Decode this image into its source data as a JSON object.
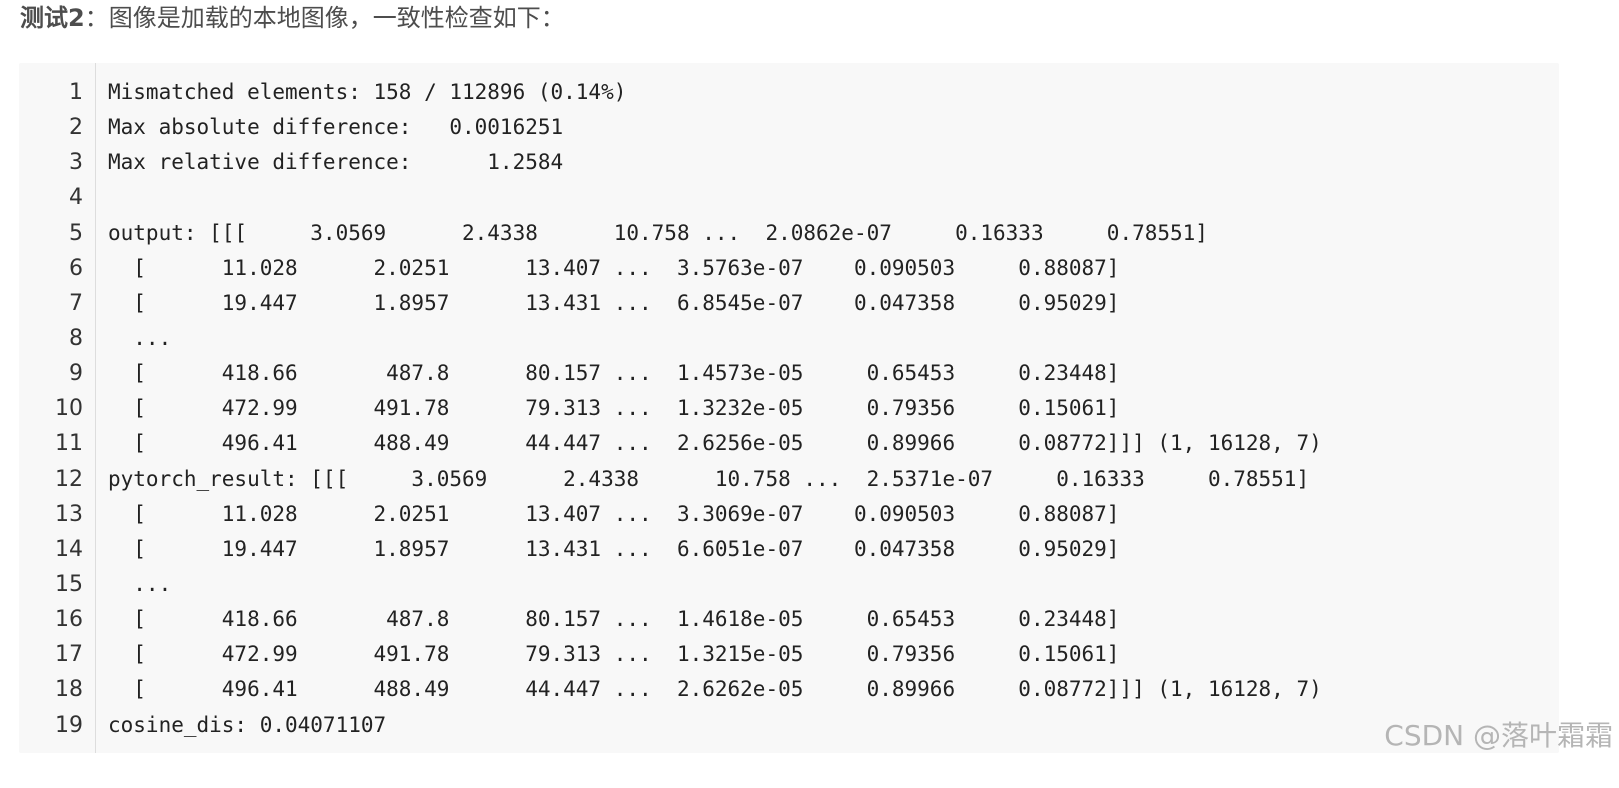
{
  "heading": {
    "bold": "测试2",
    "rest": "：图像是加载的本地图像，一致性检查如下："
  },
  "code": {
    "lines": [
      {
        "no": "1",
        "text": "Mismatched elements: 158 / 112896 (0.14%)"
      },
      {
        "no": "2",
        "text": "Max absolute difference:   0.0016251"
      },
      {
        "no": "3",
        "text": "Max relative difference:      1.2584"
      },
      {
        "no": "4",
        "text": ""
      },
      {
        "no": "5",
        "text": "output: [[[     3.0569      2.4338      10.758 ...  2.0862e-07     0.16333     0.78551]"
      },
      {
        "no": "6",
        "text": "  [      11.028      2.0251      13.407 ...  3.5763e-07    0.090503     0.88087]"
      },
      {
        "no": "7",
        "text": "  [      19.447      1.8957      13.431 ...  6.8545e-07    0.047358     0.95029]"
      },
      {
        "no": "8",
        "text": "  ..."
      },
      {
        "no": "9",
        "text": "  [      418.66       487.8      80.157 ...  1.4573e-05     0.65453     0.23448]"
      },
      {
        "no": "10",
        "text": "  [      472.99      491.78      79.313 ...  1.3232e-05     0.79356     0.15061]"
      },
      {
        "no": "11",
        "text": "  [      496.41      488.49      44.447 ...  2.6256e-05     0.89966     0.08772]]] (1, 16128, 7)"
      },
      {
        "no": "12",
        "text": "pytorch_result: [[[     3.0569      2.4338      10.758 ...  2.5371e-07     0.16333     0.78551]"
      },
      {
        "no": "13",
        "text": "  [      11.028      2.0251      13.407 ...  3.3069e-07    0.090503     0.88087]"
      },
      {
        "no": "14",
        "text": "  [      19.447      1.8957      13.431 ...  6.6051e-07    0.047358     0.95029]"
      },
      {
        "no": "15",
        "text": "  ..."
      },
      {
        "no": "16",
        "text": "  [      418.66       487.8      80.157 ...  1.4618e-05     0.65453     0.23448]"
      },
      {
        "no": "17",
        "text": "  [      472.99      491.78      79.313 ...  1.3215e-05     0.79356     0.15061]"
      },
      {
        "no": "18",
        "text": "  [      496.41      488.49      44.447 ...  2.6262e-05     0.89966     0.08772]]] (1, 16128, 7)"
      },
      {
        "no": "19",
        "text": "cosine_dis: 0.04071107"
      }
    ]
  },
  "watermark": "CSDN @落叶霜霜"
}
